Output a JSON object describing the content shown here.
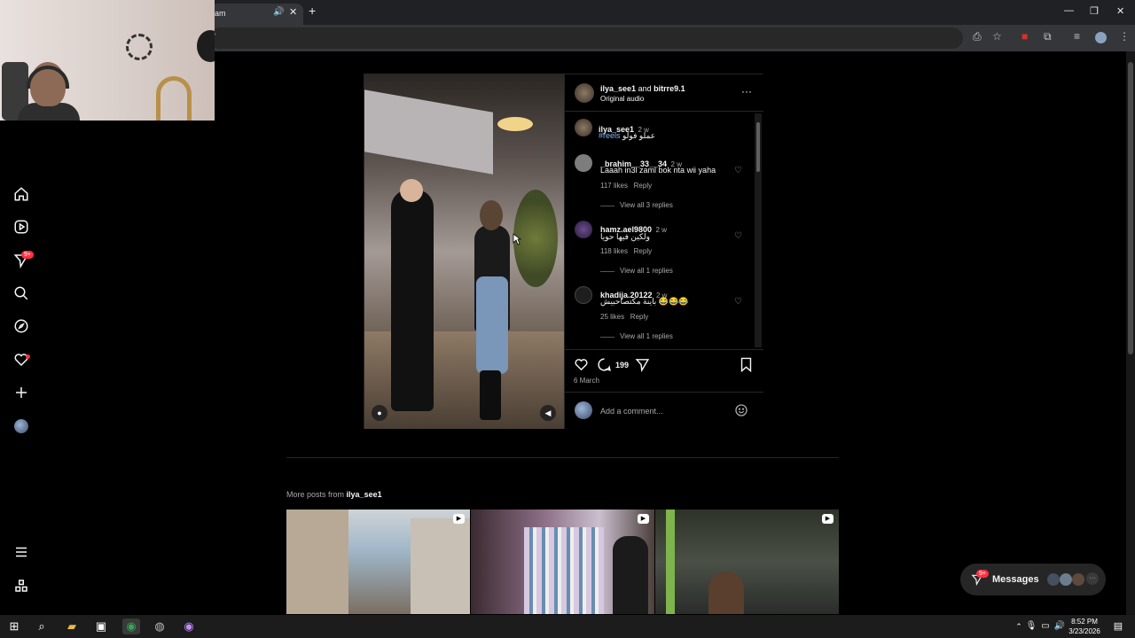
{
  "browser": {
    "tab_title": "am",
    "address": "/"
  },
  "nav": {
    "notifications_badge": "9+"
  },
  "post": {
    "header_user1": "ilya_see1",
    "header_and": "and",
    "header_user2": "bitrre9.1",
    "audio": "Original audio",
    "caption_user": "ilya_see1",
    "caption_time": "2 w",
    "caption_hashtag": "#reels",
    "caption_text": "عملو فولو",
    "comments": [
      {
        "user": "_brahim__33__34",
        "time": "2 w",
        "text": "Laaah in3l zaml bok nta wii yaha",
        "likes": "117 likes",
        "reply": "Reply",
        "view": "View all 3 replies"
      },
      {
        "user": "hamz.ael9800",
        "time": "2 w",
        "text": "ولكين فيها حويا",
        "likes": "118 likes",
        "reply": "Reply",
        "view": "View all 1 replies"
      },
      {
        "user": "khadija.20122",
        "time": "2 w",
        "text": "باينة مكتصاحبيش 😂😂😂",
        "likes": "25 likes",
        "reply": "Reply",
        "view": "View all 1 replies"
      }
    ],
    "comment_count": "199",
    "date": "6 March",
    "add_comment_placeholder": "Add a comment..."
  },
  "more_posts": {
    "prefix": "More posts from",
    "user": "ilya_see1"
  },
  "messages": {
    "label": "Messages",
    "badge": "9+"
  },
  "taskbar": {
    "time": "8:52 PM",
    "date": "3/23/2026"
  },
  "icons": {
    "home": "home-icon",
    "reels": "reels-icon",
    "direct": "paper-plane-icon",
    "search": "search-icon",
    "explore": "compass-icon",
    "notifications": "heart-icon",
    "create": "plus-icon",
    "more": "hamburger-icon",
    "threads": "apps-icon"
  },
  "colors": {
    "background": "#000000",
    "badge_red": "#ff3040",
    "hashtag": "#8ab4f8"
  }
}
